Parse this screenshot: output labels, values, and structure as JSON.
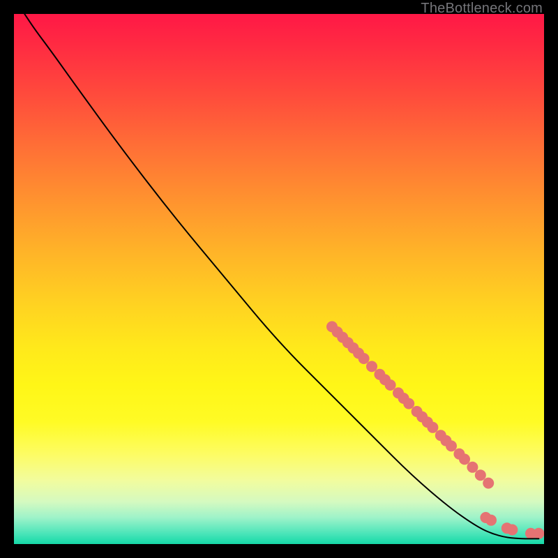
{
  "watermark": "TheBottleneck.com",
  "chart_data": {
    "type": "line",
    "title": "",
    "xlabel": "",
    "ylabel": "",
    "xlim": [
      0,
      100
    ],
    "ylim": [
      0,
      100
    ],
    "curve": {
      "name": "bottleneck-curve",
      "color": "#000000",
      "points": [
        {
          "x": 2,
          "y": 100
        },
        {
          "x": 4,
          "y": 97
        },
        {
          "x": 7,
          "y": 93
        },
        {
          "x": 12,
          "y": 86
        },
        {
          "x": 20,
          "y": 75
        },
        {
          "x": 30,
          "y": 62
        },
        {
          "x": 40,
          "y": 50
        },
        {
          "x": 50,
          "y": 38
        },
        {
          "x": 60,
          "y": 28
        },
        {
          "x": 68,
          "y": 20
        },
        {
          "x": 75,
          "y": 13
        },
        {
          "x": 82,
          "y": 7
        },
        {
          "x": 87,
          "y": 3.5
        },
        {
          "x": 90,
          "y": 2
        },
        {
          "x": 93,
          "y": 1.2
        },
        {
          "x": 96,
          "y": 1
        },
        {
          "x": 98,
          "y": 1
        },
        {
          "x": 99,
          "y": 1
        }
      ]
    },
    "markers": {
      "name": "highlighted-points",
      "color": "#e57373",
      "points": [
        {
          "x": 60,
          "y": 41
        },
        {
          "x": 61,
          "y": 40
        },
        {
          "x": 62,
          "y": 39
        },
        {
          "x": 63,
          "y": 38
        },
        {
          "x": 64,
          "y": 37
        },
        {
          "x": 65,
          "y": 36
        },
        {
          "x": 66,
          "y": 35
        },
        {
          "x": 67.5,
          "y": 33.5
        },
        {
          "x": 69,
          "y": 32
        },
        {
          "x": 70,
          "y": 31
        },
        {
          "x": 71,
          "y": 30
        },
        {
          "x": 72.5,
          "y": 28.5
        },
        {
          "x": 73.5,
          "y": 27.5
        },
        {
          "x": 74.5,
          "y": 26.5
        },
        {
          "x": 76,
          "y": 25
        },
        {
          "x": 77,
          "y": 24
        },
        {
          "x": 78,
          "y": 23
        },
        {
          "x": 79,
          "y": 22
        },
        {
          "x": 80.5,
          "y": 20.5
        },
        {
          "x": 81.5,
          "y": 19.5
        },
        {
          "x": 82.5,
          "y": 18.5
        },
        {
          "x": 84,
          "y": 17
        },
        {
          "x": 85,
          "y": 16
        },
        {
          "x": 86.5,
          "y": 14.5
        },
        {
          "x": 88,
          "y": 13
        },
        {
          "x": 89.5,
          "y": 11.5
        },
        {
          "x": 89,
          "y": 5
        },
        {
          "x": 90,
          "y": 4.5
        },
        {
          "x": 93,
          "y": 3
        },
        {
          "x": 94,
          "y": 2.7
        },
        {
          "x": 97.5,
          "y": 2
        },
        {
          "x": 99,
          "y": 2
        }
      ]
    }
  }
}
